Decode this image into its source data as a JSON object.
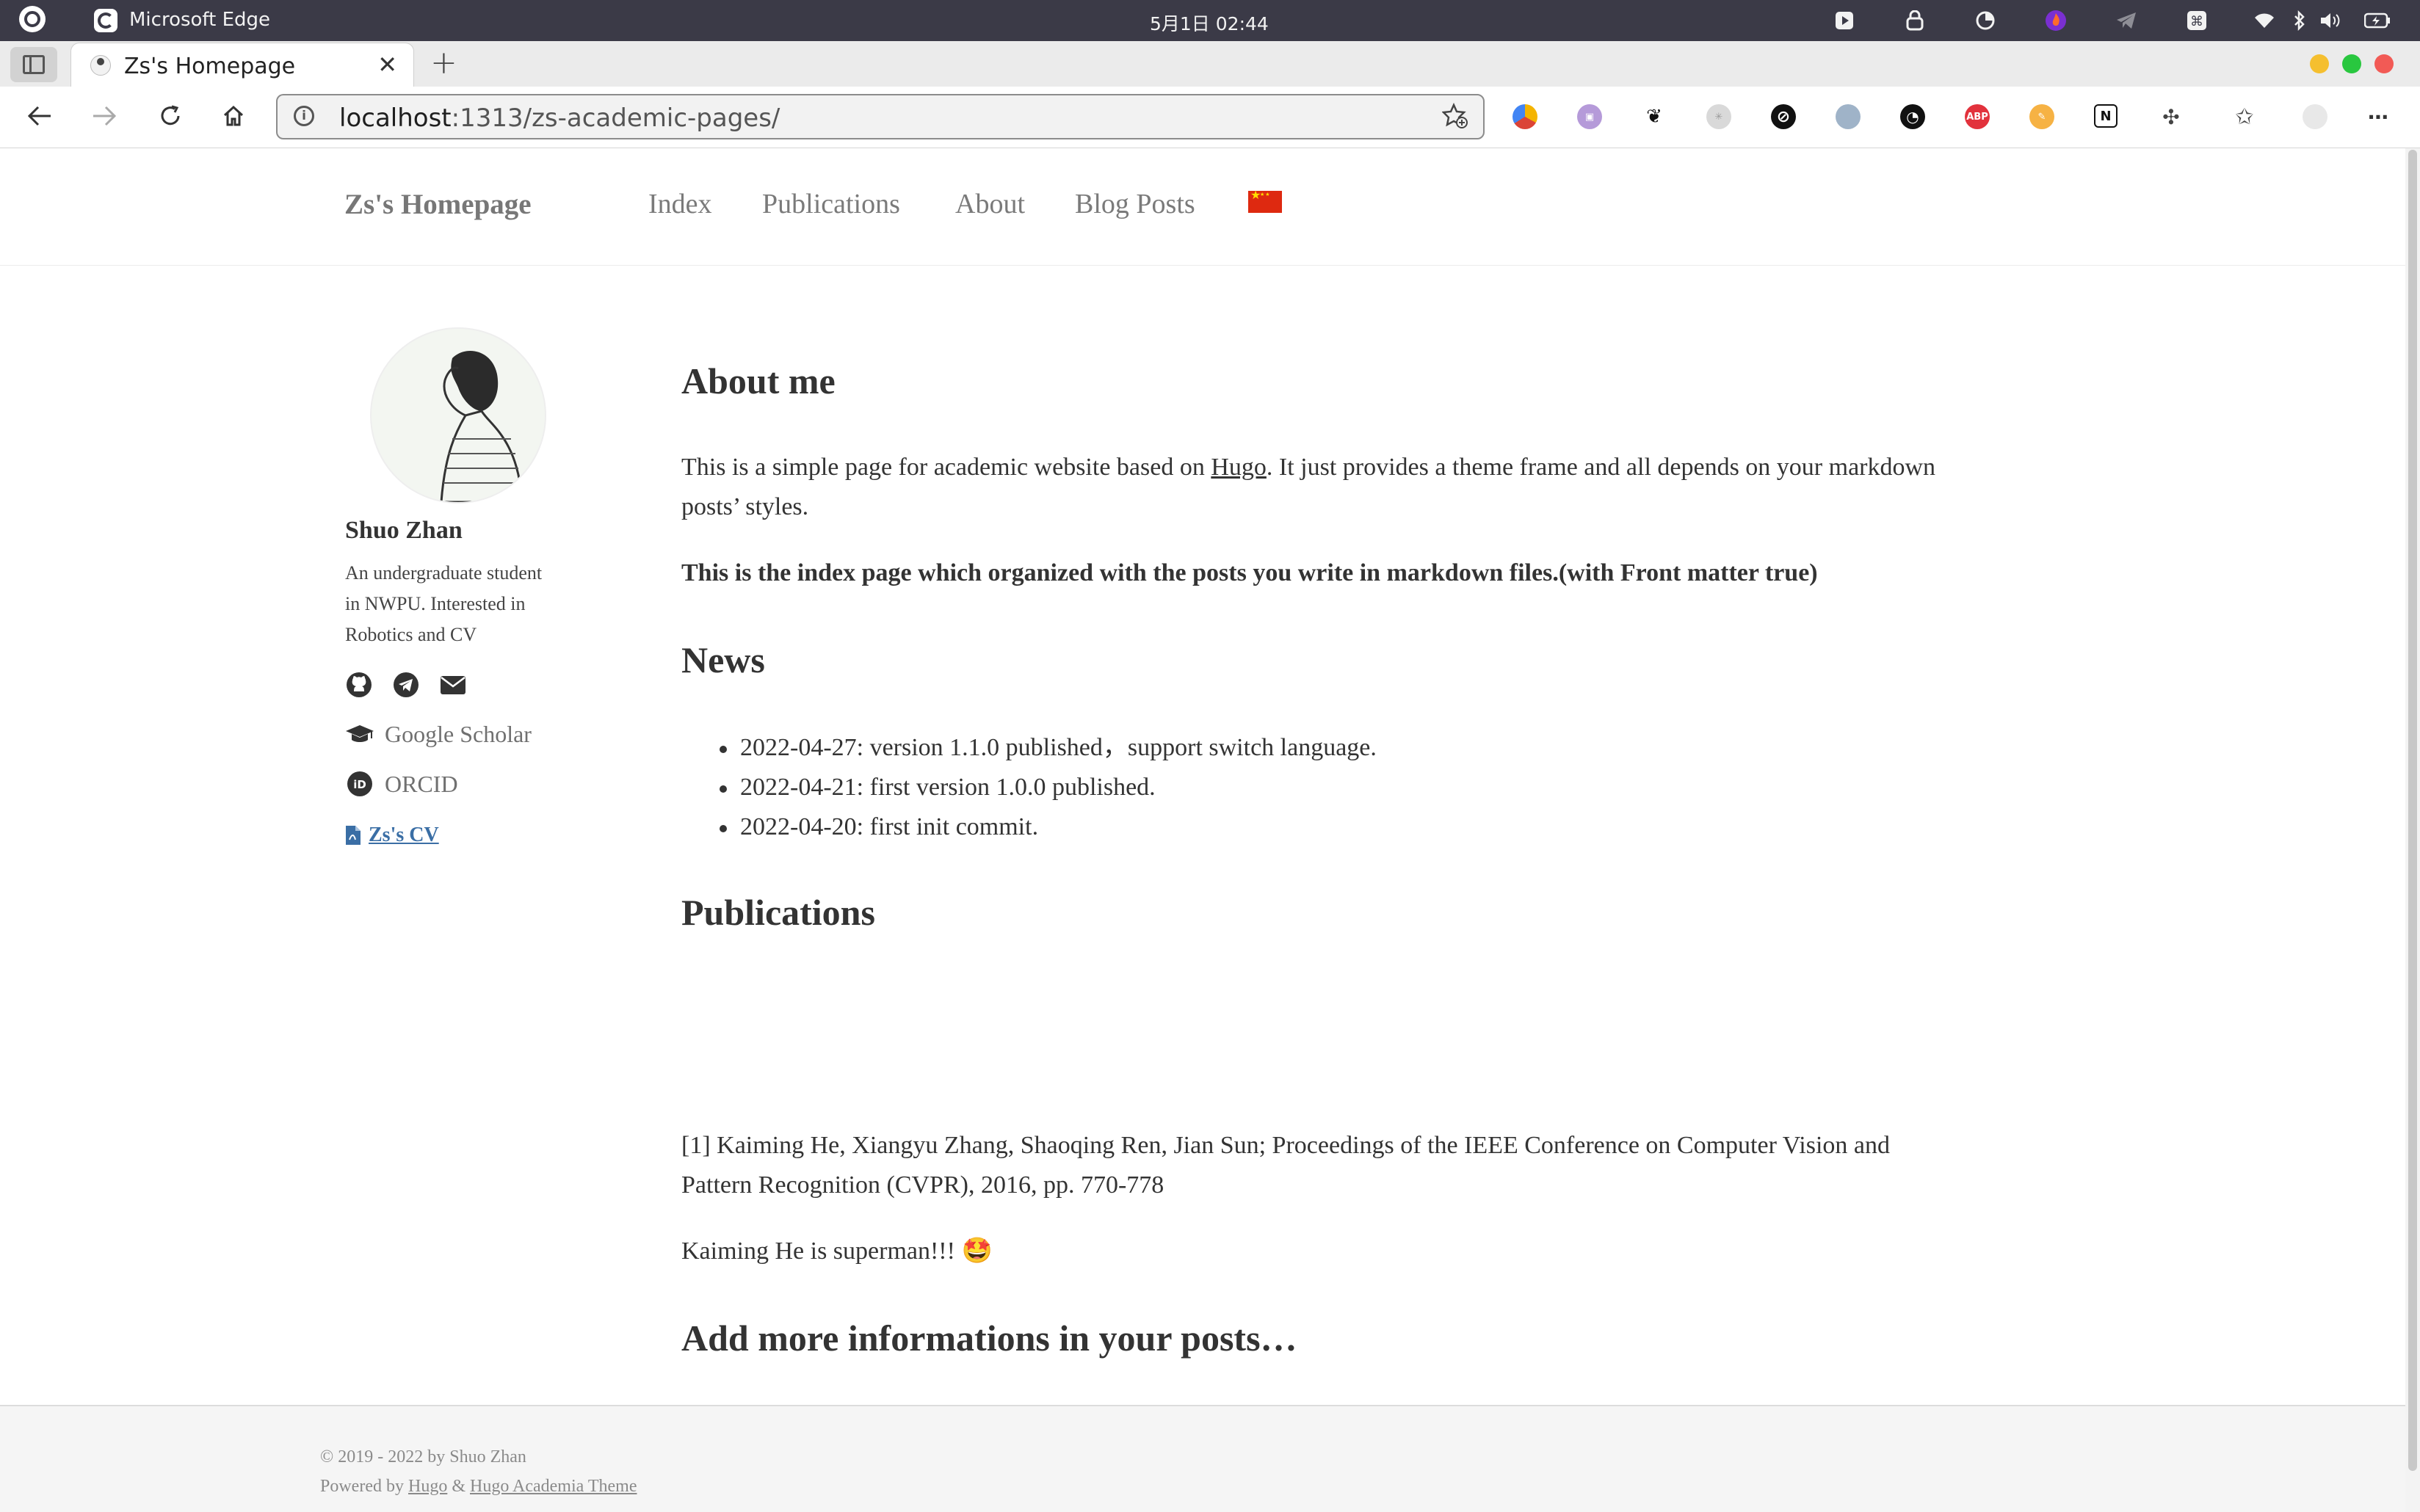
{
  "os_bar": {
    "app_name": "Microsoft Edge",
    "clock": "5月1日  02:44"
  },
  "browser": {
    "tab_title": "Zs's Homepage",
    "url_host": "localhost",
    "url_rest": ":1313/zs-academic-pages/",
    "new_tab_symbol": "+",
    "close_symbol": "✕"
  },
  "site": {
    "brand": "Zs's Homepage",
    "nav": {
      "index": "Index",
      "publications": "Publications",
      "about": "About",
      "blog": "Blog Posts"
    }
  },
  "sidebar": {
    "name": "Shuo Zhan",
    "bio_line1": "An undergraduate student",
    "bio_line2": "in NWPU. Interested in",
    "bio_line3": "Robotics and CV",
    "scholar": "Google Scholar",
    "orcid": "ORCID",
    "cv": "Zs's CV"
  },
  "main": {
    "about_heading": "About me",
    "about_text_1": "This is a simple page for academic website based on ",
    "about_link": "Hugo",
    "about_text_2": ". It just provides a theme frame and all depends on your markdown",
    "about_text_3": "posts’ styles.",
    "index_note": "This is the index page which organized with the posts you write in markdown files.(with Front matter true)",
    "news_heading": "News",
    "news": [
      "2022-04-27: version 1.1.0 published，support switch language.",
      "2022-04-21: first version 1.0.0 published.",
      "2022-04-20: first init commit."
    ],
    "pub_heading": "Publications",
    "pub_line1": "[1] Kaiming He, Xiangyu Zhang, Shaoqing Ren, Jian Sun; Proceedings of the IEEE Conference on Computer Vision and",
    "pub_line2": "Pattern Recognition (CVPR), 2016, pp. 770-778",
    "superman": "Kaiming He is superman!!! 🤩",
    "more_heading": "Add more informations in your posts…"
  },
  "footer": {
    "copyright": "© 2019 - 2022 by Shuo Zhan",
    "powered_by": "Powered by ",
    "hugo": "Hugo",
    "amp": " & ",
    "theme": "Hugo Academia Theme"
  },
  "colors": {
    "os_bar": "#3b3a47",
    "link_blue": "#3a6ea5",
    "win_minimize": "#f5bf2f",
    "win_maximize": "#29c73f",
    "win_close": "#f25a55"
  },
  "icons": [
    "ubuntu-icon",
    "edge-icon",
    "sidebar-toggle-icon",
    "back-icon",
    "forward-icon",
    "refresh-icon",
    "home-icon",
    "info-icon",
    "favorite-add-icon",
    "github-icon",
    "telegram-icon",
    "mail-icon",
    "graduation-cap-icon",
    "orcid-icon",
    "pdf-file-icon",
    "china-flag-icon"
  ]
}
